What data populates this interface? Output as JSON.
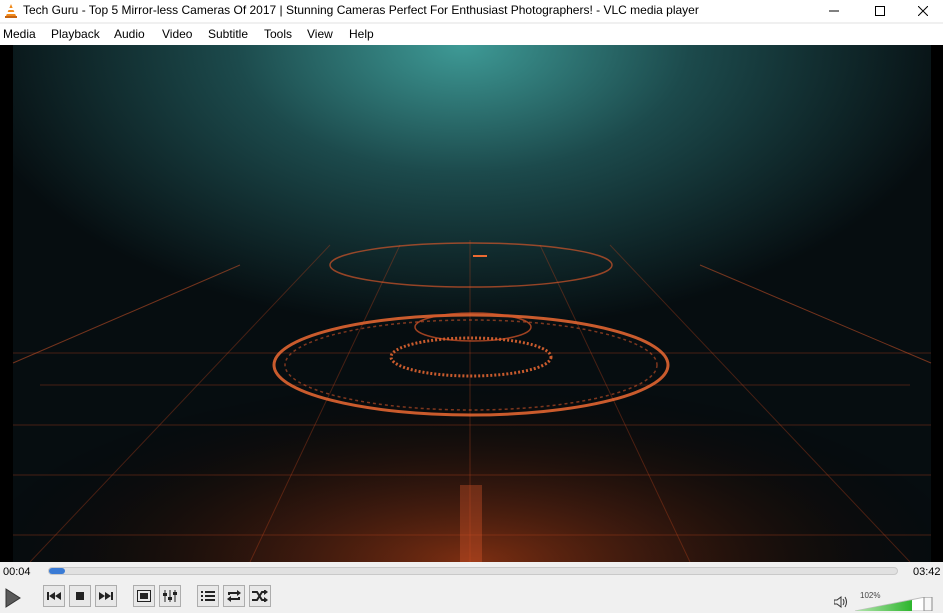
{
  "window": {
    "title": "Tech Guru - Top 5 Mirror-less Cameras Of 2017 | Stunning Cameras Perfect For Enthusiast Photographers! - VLC media player",
    "icons": [
      "vlc-cone-icon",
      "minimize-icon",
      "maximize-icon",
      "close-icon"
    ]
  },
  "menu": {
    "items": [
      "Media",
      "Playback",
      "Audio",
      "Video",
      "Subtitle",
      "Tools",
      "View",
      "Help"
    ]
  },
  "playback": {
    "elapsed": "00:04",
    "total": "03:42",
    "progress": 0.018
  },
  "volume": {
    "label": "102%",
    "level": 1.02
  },
  "controls": {
    "icons": [
      "play-icon",
      "previous-icon",
      "stop-icon",
      "next-icon",
      "fullscreen-icon",
      "extended-settings-icon",
      "playlist-icon",
      "loop-icon",
      "random-icon",
      "speaker-icon"
    ]
  },
  "colors": {
    "progress_fill": "#3a7bd5",
    "volume_green": "#2db52d",
    "video_glow": "#e0592a"
  }
}
